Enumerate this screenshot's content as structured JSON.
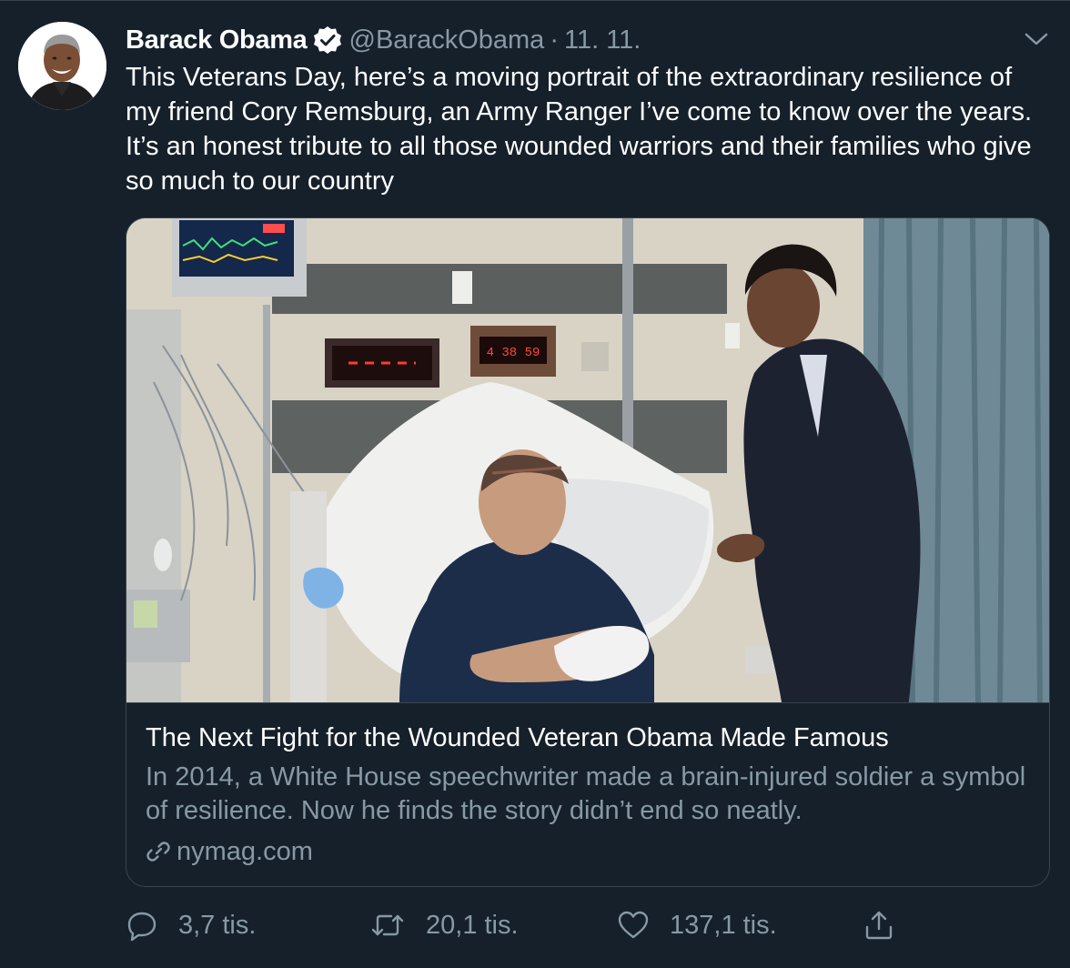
{
  "author": {
    "display_name": "Barack Obama",
    "handle": "@BarackObama",
    "separator": "·",
    "date": "11. 11.",
    "verified": true,
    "avatar_icon": "profile-photo"
  },
  "tweet": {
    "text": "This Veterans Day, here’s a moving portrait of the extraordinary resilience of my friend Cory Remsburg, an Army Ranger I’ve come to know over the years. It’s an honest tribute to all those wounded warriors and their families who give so much to our country"
  },
  "card": {
    "image_icon": "hospital-room-photo",
    "monitor_readout": "4 38 59",
    "title": "The Next Fight for the Wounded Veteran Obama Made Famous",
    "description": "In 2014, a White House speechwriter made a brain-injured soldier a symbol of resilience. Now he finds the story didn’t end so neatly.",
    "domain": "nymag.com"
  },
  "actions": {
    "reply_count": "3,7 tis.",
    "retweet_count": "20,1 tis.",
    "like_count": "137,1 tis."
  },
  "colors": {
    "background": "#15202b",
    "border": "#38444d",
    "secondary_text": "#8899a6",
    "primary_text": "#ffffff"
  }
}
